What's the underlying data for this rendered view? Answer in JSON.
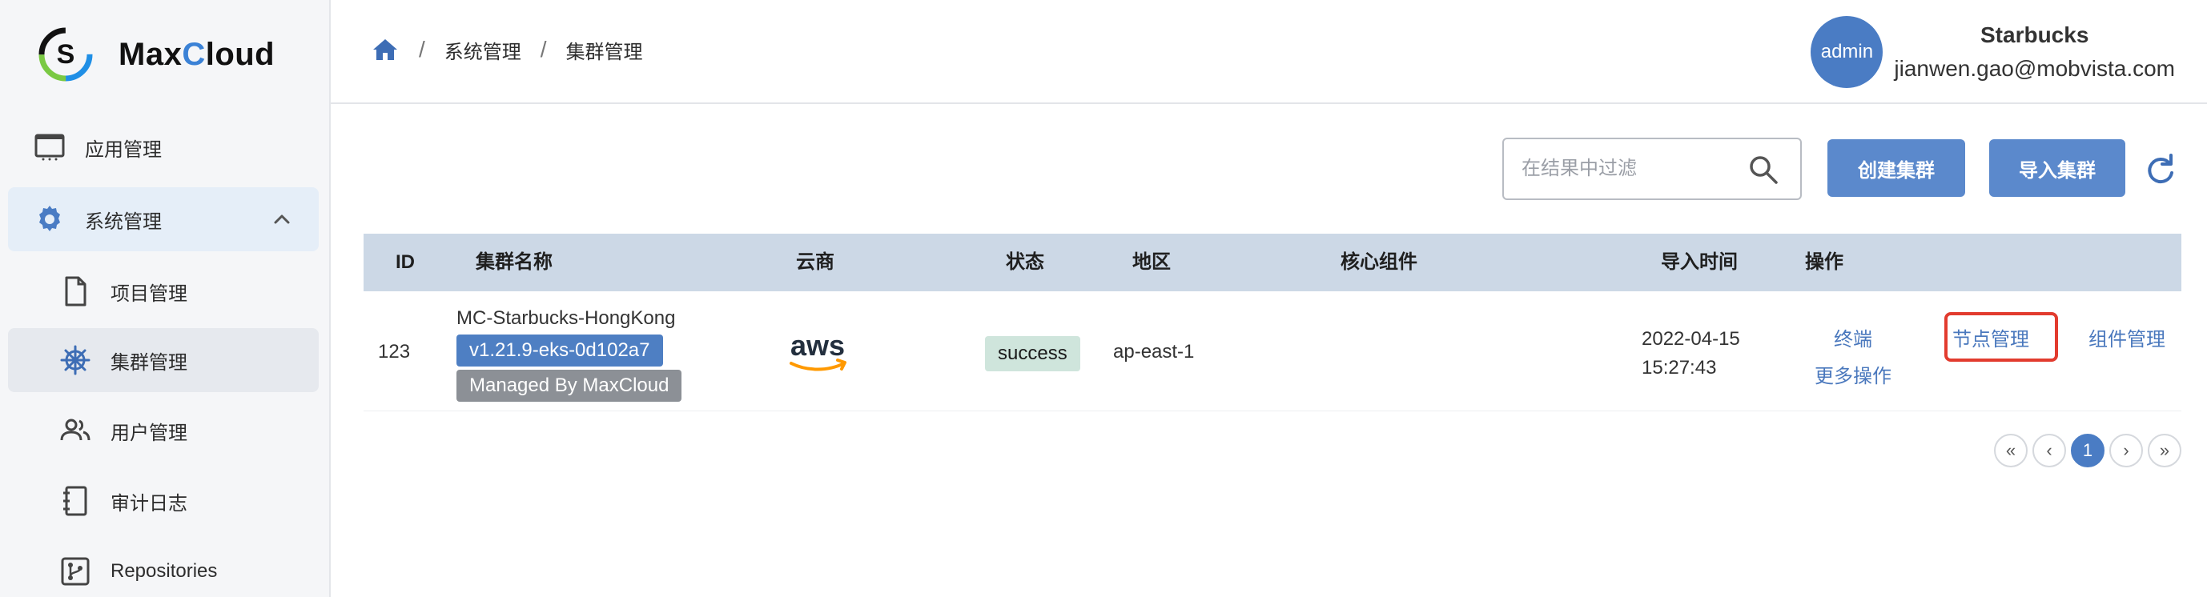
{
  "app": {
    "name_left": "Max",
    "name_x": "C",
    "name_right": "loud"
  },
  "sidebar": {
    "items": [
      {
        "label": "应用管理",
        "icon": "monitor-icon"
      },
      {
        "label": "系统管理",
        "icon": "gear-icon",
        "expanded": true
      },
      {
        "label": "项目管理",
        "icon": "document-icon"
      },
      {
        "label": "集群管理",
        "icon": "helm-wheel-icon",
        "active": true
      },
      {
        "label": "用户管理",
        "icon": "users-icon"
      },
      {
        "label": "审计日志",
        "icon": "notebook-icon"
      },
      {
        "label": "Repositories",
        "icon": "repository-icon"
      }
    ]
  },
  "header": {
    "breadcrumb": [
      "系统管理",
      "集群管理"
    ],
    "user": {
      "avatar_text": "admin",
      "org": "Starbucks",
      "email": "jianwen.gao@mobvista.com"
    }
  },
  "toolbar": {
    "search_placeholder": "在结果中过滤",
    "create_label": "创建集群",
    "import_label": "导入集群"
  },
  "table": {
    "columns": [
      "ID",
      "集群名称",
      "云商",
      "状态",
      "地区",
      "核心组件",
      "导入时间",
      "操作"
    ],
    "rows": [
      {
        "id": "123",
        "name": "MC-Starbucks-HongKong",
        "version": "v1.21.9-eks-0d102a7",
        "managed": "Managed By MaxCloud",
        "provider": "aws",
        "status": "success",
        "region": "ap-east-1",
        "core_components": "",
        "import_date": "2022-04-15",
        "import_time": "15:27:43",
        "actions": {
          "terminal": "终端",
          "more": "更多操作",
          "nodes": "节点管理",
          "components": "组件管理"
        }
      }
    ]
  },
  "pagination": {
    "first": "«",
    "prev": "‹",
    "current": "1",
    "next": "›",
    "last": "»"
  },
  "colors": {
    "accent": "#4a7cc4",
    "primary_button": "#5b89cc",
    "link": "#4a78bd",
    "success_bg": "#cfe5dc",
    "highlight_border": "#e23b2e",
    "table_header_bg": "#ccd8e6"
  }
}
